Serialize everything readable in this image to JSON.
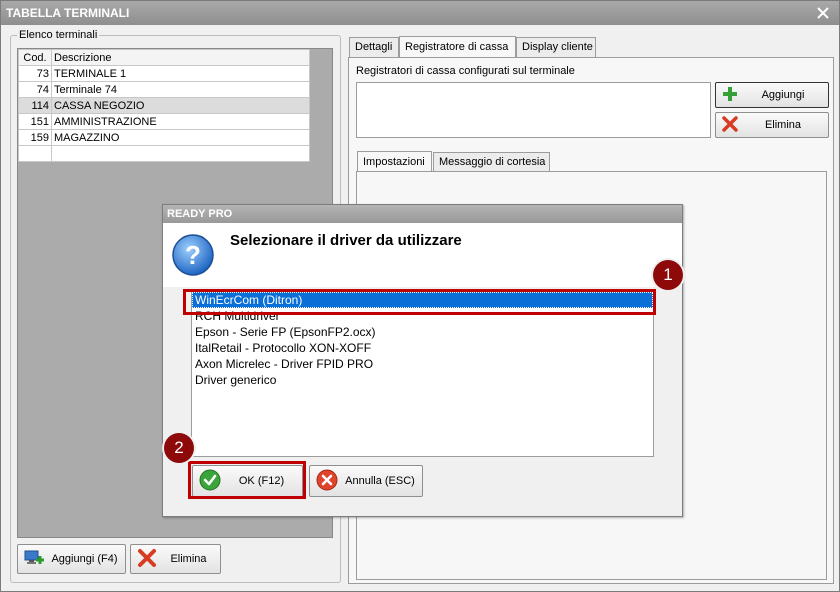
{
  "window": {
    "title": "TABELLA TERMINALI"
  },
  "terminals": {
    "group_label": "Elenco terminali",
    "columns": [
      "Cod.",
      "Descrizione"
    ],
    "rows": [
      {
        "cod": "73",
        "desc": "TERMINALE 1"
      },
      {
        "cod": "74",
        "desc": "Terminale 74"
      },
      {
        "cod": "114",
        "desc": "CASSA NEGOZIO"
      },
      {
        "cod": "151",
        "desc": "AMMINISTRAZIONE"
      },
      {
        "cod": "159",
        "desc": "MAGAZZINO"
      }
    ],
    "add_label": "Aggiungi (F4)",
    "delete_label": "Elimina"
  },
  "tabs": {
    "main": [
      "Dettagli",
      "Registratore di cassa",
      "Display cliente"
    ],
    "inner": [
      "Impostazioni",
      "Messaggio di cortesia"
    ]
  },
  "register": {
    "label": "Registratori di cassa configurati sul terminale",
    "add_label": "Aggiungi",
    "delete_label": "Elimina"
  },
  "dialog": {
    "title": "READY PRO",
    "message": "Selezionare il driver da utilizzare",
    "drivers": [
      "WinEcrCom (Ditron)",
      "RCH Multidriver",
      "Epson - Serie FP (EpsonFP2.ocx)",
      "ItalRetail - Protocollo XON-XOFF",
      "Axon Micrelec - Driver FPID PRO",
      "Driver generico"
    ],
    "selected_driver": "WinEcrCom (Ditron)",
    "ok_label": "OK (F12)",
    "cancel_label": "Annulla (ESC)"
  },
  "annotations": {
    "step1": "1",
    "step2": "2"
  },
  "colors": {
    "selection": "#0a6fd6",
    "annotation_red": "#c00000",
    "badge": "#8e0a0a"
  }
}
